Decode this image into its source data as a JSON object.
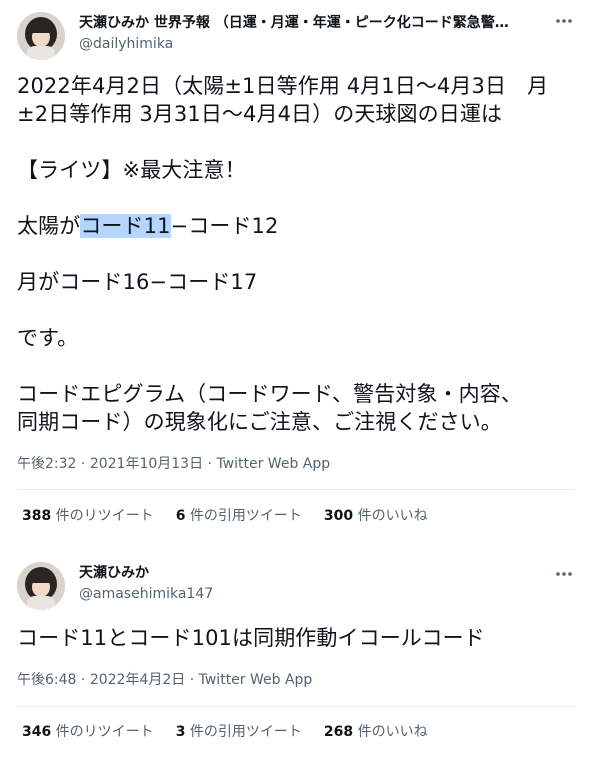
{
  "tweet1": {
    "display_name": "天瀬ひみか 世界予報 （日運・月運・年運・ピーク化コード緊急警…",
    "handle": "@dailyhimika",
    "body": {
      "line1": "2022年4月2日（太陽±1日等作用 4月1日〜4月3日　月",
      "line2": "±2日等作用 3月31日〜4月4日）の天球図の日運は",
      "line3": "【ライツ】※最大注意！",
      "line4_prefix": "太陽が",
      "line4_highlight": "コード11",
      "line4_suffix": "−コード12",
      "line5": "月がコード16−コード17",
      "line6": "です。",
      "line7": "コードエピグラム（コードワード、警告対象・内容、",
      "line8": "同期コード）の現象化にご注意、ご注視ください。"
    },
    "time": "午後2:32",
    "sep1": " · ",
    "date": "2021年10月13日",
    "sep2": " · ",
    "source": "Twitter Web App",
    "stats": {
      "retweets_count": "388",
      "retweets_label": " 件のリツイート",
      "quotes_count": "6",
      "quotes_label": " 件の引用ツイート",
      "likes_count": "300",
      "likes_label": " 件のいいね"
    }
  },
  "tweet2": {
    "display_name": "天瀬ひみか",
    "handle": "@amasehimika147",
    "body": "コード11とコード101は同期作動イコールコード",
    "time": "午後6:48",
    "sep1": " · ",
    "date": "2022年4月2日",
    "sep2": " · ",
    "source": "Twitter Web App",
    "stats": {
      "retweets_count": "346",
      "retweets_label": " 件のリツイート",
      "quotes_count": "3",
      "quotes_label": " 件の引用ツイート",
      "likes_count": "268",
      "likes_label": " 件のいいね"
    }
  },
  "icons": {
    "more": "more-horizontal-icon",
    "avatar": "profile-photo"
  },
  "colors": {
    "text_primary": "#0f1419",
    "text_secondary": "#536471",
    "divider": "#e6ecf0",
    "selection": "#b4d5fe"
  }
}
